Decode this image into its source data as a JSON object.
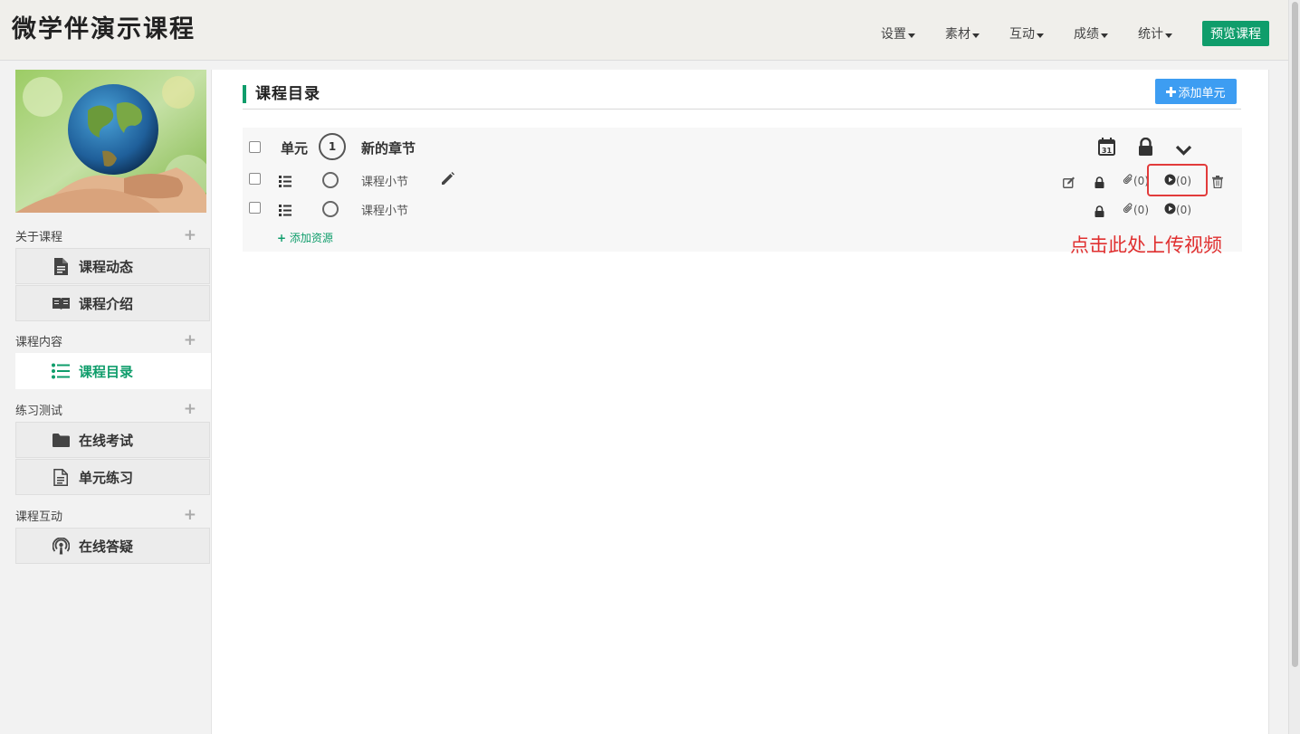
{
  "header": {
    "site_title": "微学伴演示课程",
    "nav": [
      {
        "label": "设置"
      },
      {
        "label": "素材"
      },
      {
        "label": "互动"
      },
      {
        "label": "成绩"
      },
      {
        "label": "统计"
      }
    ],
    "preview_label": "预览课程"
  },
  "sidebar": {
    "sections": [
      {
        "title": "关于课程",
        "items": [
          {
            "label": "课程动态",
            "icon": "document-icon"
          },
          {
            "label": "课程介绍",
            "icon": "book-icon"
          }
        ]
      },
      {
        "title": "课程内容",
        "items": [
          {
            "label": "课程目录",
            "icon": "list-icon",
            "active": true
          }
        ]
      },
      {
        "title": "练习测试",
        "items": [
          {
            "label": "在线考试",
            "icon": "folder-icon"
          },
          {
            "label": "单元练习",
            "icon": "file-icon"
          }
        ]
      },
      {
        "title": "课程互动",
        "items": [
          {
            "label": "在线答疑",
            "icon": "podcast-icon"
          }
        ]
      }
    ]
  },
  "main": {
    "title": "课程目录",
    "add_unit_label": "添加单元",
    "unit": {
      "label": "单元",
      "number": "1",
      "chapter_title": "新的章节",
      "lessons": [
        {
          "title": "课程小节",
          "attachments": "(0)",
          "videos": "(0)"
        },
        {
          "title": "课程小节",
          "attachments": "(0)",
          "videos": "(0)"
        }
      ],
      "add_resource_label": "添加资源"
    },
    "annotation": "点击此处上传视频"
  },
  "colors": {
    "accent": "#0f9d6b",
    "button_blue": "#3d9df2",
    "annotation_red": "#e03030"
  }
}
